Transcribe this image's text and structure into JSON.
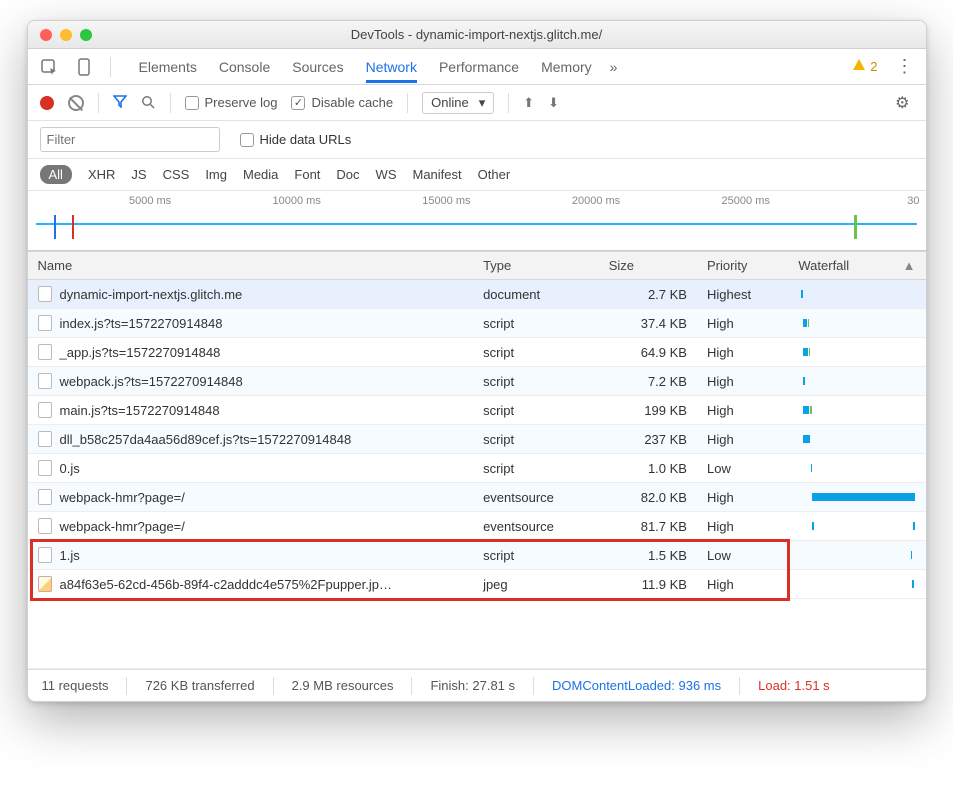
{
  "window": {
    "title": "DevTools - dynamic-import-nextjs.glitch.me/"
  },
  "tabs": {
    "items": [
      "Elements",
      "Console",
      "Sources",
      "Network",
      "Performance",
      "Memory"
    ],
    "active": "Network",
    "more": "»",
    "warnings": "2"
  },
  "toolbar": {
    "preserve_label": "Preserve log",
    "disable_label": "Disable cache",
    "online": "Online"
  },
  "filters": {
    "placeholder": "Filter",
    "hide_label": "Hide data URLs",
    "types": [
      "All",
      "XHR",
      "JS",
      "CSS",
      "Img",
      "Media",
      "Font",
      "Doc",
      "WS",
      "Manifest",
      "Other"
    ],
    "active": "All"
  },
  "timeline": {
    "ticks": [
      "5000 ms",
      "10000 ms",
      "15000 ms",
      "20000 ms",
      "25000 ms",
      "30"
    ]
  },
  "columns": {
    "name": "Name",
    "type": "Type",
    "size": "Size",
    "priority": "Priority",
    "waterfall": "Waterfall"
  },
  "rows": [
    {
      "name": "dynamic-import-nextjs.glitch.me",
      "type": "document",
      "size": "2.7 KB",
      "priority": "Highest",
      "icon": "doc",
      "wf": [
        {
          "l": 2,
          "w": 2,
          "c": "#0aa1e6"
        }
      ],
      "sel": true
    },
    {
      "name": "index.js?ts=1572270914848",
      "type": "script",
      "size": "37.4 KB",
      "priority": "High",
      "icon": "doc",
      "wf": [
        {
          "l": 4,
          "w": 3,
          "c": "#0aa1e6"
        },
        {
          "l": 8,
          "w": 1,
          "c": "#6cc24a"
        }
      ]
    },
    {
      "name": "_app.js?ts=1572270914848",
      "type": "script",
      "size": "64.9 KB",
      "priority": "High",
      "icon": "doc",
      "wf": [
        {
          "l": 4,
          "w": 4,
          "c": "#0aa1e6"
        },
        {
          "l": 9,
          "w": 1,
          "c": "#6cc24a"
        }
      ]
    },
    {
      "name": "webpack.js?ts=1572270914848",
      "type": "script",
      "size": "7.2 KB",
      "priority": "High",
      "icon": "doc",
      "wf": [
        {
          "l": 4,
          "w": 2,
          "c": "#0aa1e6"
        }
      ]
    },
    {
      "name": "main.js?ts=1572270914848",
      "type": "script",
      "size": "199 KB",
      "priority": "High",
      "icon": "doc",
      "wf": [
        {
          "l": 4,
          "w": 5,
          "c": "#0aa1e6"
        },
        {
          "l": 10,
          "w": 2,
          "c": "#6cc24a"
        }
      ]
    },
    {
      "name": "dll_b58c257da4aa56d89cef.js?ts=1572270914848",
      "type": "script",
      "size": "237 KB",
      "priority": "High",
      "icon": "doc",
      "wf": [
        {
          "l": 4,
          "w": 6,
          "c": "#0aa1e6"
        }
      ]
    },
    {
      "name": "0.js",
      "type": "script",
      "size": "1.0 KB",
      "priority": "Low",
      "icon": "doc",
      "wf": [
        {
          "l": 11,
          "w": 1,
          "c": "#0aa1e6"
        }
      ]
    },
    {
      "name": "webpack-hmr?page=/",
      "type": "eventsource",
      "size": "82.0 KB",
      "priority": "High",
      "icon": "doc",
      "wf": [
        {
          "l": 12,
          "w": 88,
          "c": "#0aa1e6"
        }
      ]
    },
    {
      "name": "webpack-hmr?page=/",
      "type": "eventsource",
      "size": "81.7 KB",
      "priority": "High",
      "icon": "doc",
      "wf": [
        {
          "l": 12,
          "w": 1,
          "c": "#0aa1e6"
        },
        {
          "l": 98,
          "w": 2,
          "c": "#0aa1e6"
        }
      ]
    },
    {
      "name": "1.js",
      "type": "script",
      "size": "1.5 KB",
      "priority": "Low",
      "icon": "doc",
      "wf": [
        {
          "l": 96,
          "w": 1,
          "c": "#0aa1e6"
        }
      ],
      "hl": true
    },
    {
      "name": "a84f63e5-62cd-456b-89f4-c2adddc4e575%2Fpupper.jp…",
      "type": "jpeg",
      "size": "11.9 KB",
      "priority": "High",
      "icon": "img",
      "wf": [
        {
          "l": 97,
          "w": 2,
          "c": "#0aa1e6"
        }
      ],
      "hl": true
    }
  ],
  "status": {
    "requests": "11 requests",
    "transferred": "726 KB transferred",
    "resources": "2.9 MB resources",
    "finish": "Finish: 27.81 s",
    "dcl": "DOMContentLoaded: 936 ms",
    "load": "Load: 1.51 s"
  }
}
